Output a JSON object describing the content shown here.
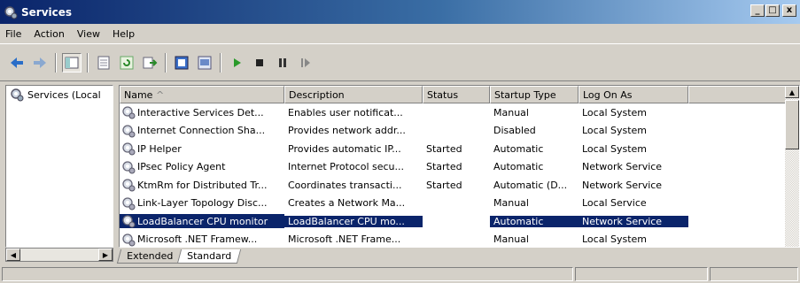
{
  "window": {
    "title": "Services",
    "icon": "services-gear-icon",
    "controls": {
      "minimize": "_",
      "maximize": "□",
      "close": "x"
    }
  },
  "menu": {
    "items": [
      "File",
      "Action",
      "View",
      "Help"
    ]
  },
  "toolbar": {
    "buttons": [
      "back-icon",
      "forward-icon",
      "show-hide-console-tree-icon",
      "export-list-icon",
      "refresh-icon",
      "properties-icon",
      "help-icon",
      "view-icon",
      "start-icon",
      "stop-icon",
      "pause-icon",
      "resume-icon"
    ]
  },
  "tree": {
    "root": "Services (Local"
  },
  "list": {
    "columns": [
      "Name",
      "Description",
      "Status",
      "Startup Type",
      "Log On As"
    ],
    "sort_indicator": "^",
    "rows": [
      {
        "name": "Interactive Services Det...",
        "description": "Enables user notificat...",
        "status": "",
        "startup": "Manual",
        "logon": "Local System",
        "selected": false
      },
      {
        "name": "Internet Connection Sha...",
        "description": "Provides network addr...",
        "status": "",
        "startup": "Disabled",
        "logon": "Local System",
        "selected": false
      },
      {
        "name": "IP Helper",
        "description": "Provides automatic IP...",
        "status": "Started",
        "startup": "Automatic",
        "logon": "Local System",
        "selected": false
      },
      {
        "name": "IPsec Policy Agent",
        "description": "Internet Protocol secu...",
        "status": "Started",
        "startup": "Automatic",
        "logon": "Network Service",
        "selected": false
      },
      {
        "name": "KtmRm for Distributed Tr...",
        "description": "Coordinates transacti...",
        "status": "Started",
        "startup": "Automatic (D...",
        "logon": "Network Service",
        "selected": false
      },
      {
        "name": "Link-Layer Topology Disc...",
        "description": "Creates a Network Ma...",
        "status": "",
        "startup": "Manual",
        "logon": "Local Service",
        "selected": false
      },
      {
        "name": "LoadBalancer CPU monitor",
        "description": "LoadBalancer CPU mo...",
        "status": "",
        "startup": "Automatic",
        "logon": "Network Service",
        "selected": true
      },
      {
        "name": "Microsoft .NET Framew...",
        "description": "Microsoft .NET Frame...",
        "status": "",
        "startup": "Manual",
        "logon": "Local System",
        "selected": false
      }
    ]
  },
  "tabs": [
    {
      "label": "Extended",
      "active": false
    },
    {
      "label": "Standard",
      "active": true
    }
  ],
  "colors": {
    "titlebar": "#0a246a",
    "selection": "#0a246a",
    "face": "#d4d0c8"
  }
}
